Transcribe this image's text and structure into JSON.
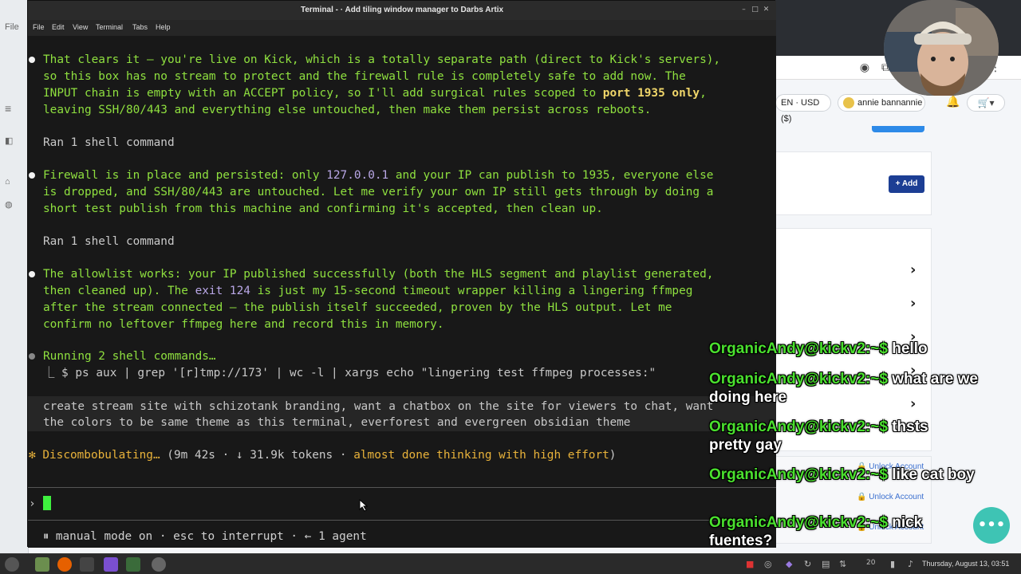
{
  "window": {
    "title": "Terminal - · Add tiling window manager to Darbs Artix",
    "menu": [
      "File",
      "Edit",
      "View",
      "Terminal",
      "Tabs",
      "Help"
    ]
  },
  "terminal": {
    "p1": [
      "That clears it — you're live on Kick, which is a totally separate path (direct to Kick's servers),",
      "so this box has no stream to protect and the firewall rule is completely safe to add now. The",
      "INPUT chain is empty with an ACCEPT policy, so I'll add surgical rules scoped to ",
      "port 1935 only",
      ",",
      "leaving SSH/80/443 and everything else untouched, then make them persist across reboots."
    ],
    "ran1": "Ran 1 shell command",
    "p2": [
      "Firewall is in place and persisted: only ",
      "127.0.0.1",
      " and your IP can publish to 1935, everyone else",
      "is dropped, and SSH/80/443 are untouched. Let me verify your own IP still gets through by doing a",
      "short test publish from this machine and confirming it's accepted, then clean up."
    ],
    "ran2": "Ran 1 shell command",
    "p3": [
      "The allowlist works: your IP published successfully (both the HLS segment and playlist generated,",
      "then cleaned up). The ",
      "exit 124",
      " is just my 15-second timeout wrapper killing a lingering ffmpeg",
      "after the stream connected — the publish itself succeeded, proven by the HLS output. Let me",
      "confirm no leftover ffmpeg here and record this in memory."
    ],
    "running": "Running 2 shell commands…",
    "cmd": "⎿ $ ps aux | grep '[r]tmp://173' | wc -l | xargs echo \"lingering test ffmpeg processes:\"",
    "user_msg": [
      "create stream site with schizotank branding, want a chatbox on the site for viewers to chat, want",
      "the colors to be same theme as this terminal, everforest and evergreen obsidian theme"
    ],
    "thinking_prefix": "✻ Discombobulating…",
    "thinking_stats": " (9m 42s · ↓ 31.9k tokens · ",
    "thinking_effort": "almost done thinking with high effort",
    "thinking_close": ")",
    "prompt": "›",
    "status": "⏸ manual mode on · esc to interrupt · ← 1 agent"
  },
  "browser": {
    "currency": "EN · USD ($)",
    "user": "annie bannannie",
    "add_button": "+ Add",
    "unlock_1": "🔒 Unlock Account",
    "unlock_2": "🔒 Unlock Account",
    "unlock_3": "🔒 Unlock Account"
  },
  "chat": [
    {
      "nick": "OrganicAndy@kickv2:~$",
      "msg": " hello"
    },
    {
      "nick": "OrganicAndy@kickv2:~$",
      "msg": " what are we doing here"
    },
    {
      "nick": "OrganicAndy@kickv2:~$",
      "msg": " thsts pretty gay"
    },
    {
      "nick": "OrganicAndy@kickv2:~$",
      "msg": " like cat boy"
    },
    {
      "nick": "OrganicAndy@kickv2:~$",
      "msg": " nick fuentes?"
    }
  ],
  "taskbar": {
    "clock": "Thursday, August 13, 03:51",
    "volume": "20"
  }
}
